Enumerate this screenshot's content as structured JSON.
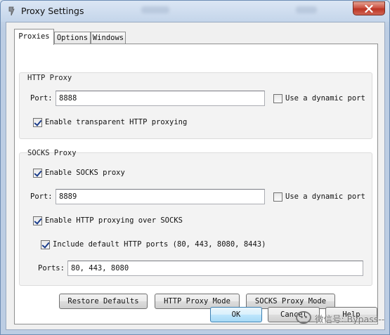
{
  "window": {
    "title": "Proxy Settings"
  },
  "tabs": [
    {
      "label": "Proxies",
      "active": true
    },
    {
      "label": "Options",
      "active": false
    },
    {
      "label": "Windows",
      "active": false
    }
  ],
  "http_proxy": {
    "group_title": "HTTP Proxy",
    "port_label": "Port:",
    "port_value": "8888",
    "dynamic_port_label": "Use a dynamic port",
    "dynamic_port_checked": false,
    "transparent_label": "Enable transparent HTTP proxying",
    "transparent_checked": true
  },
  "socks_proxy": {
    "group_title": "SOCKS Proxy",
    "enable_label": "Enable SOCKS proxy",
    "enable_checked": true,
    "port_label": "Port:",
    "port_value": "8889",
    "dynamic_port_label": "Use a dynamic port",
    "dynamic_port_checked": false,
    "http_over_socks_label": "Enable HTTP proxying over SOCKS",
    "http_over_socks_checked": true,
    "include_default_label": "Include default HTTP ports (80, 443, 8080, 8443)",
    "include_default_checked": true,
    "ports_label": "Ports:",
    "ports_value": "80, 443, 8080"
  },
  "panel_buttons": {
    "restore_defaults": "Restore Defaults",
    "http_proxy_mode": "HTTP Proxy Mode",
    "socks_proxy_mode": "SOCKS Proxy Mode"
  },
  "dialog_buttons": {
    "ok": "OK",
    "cancel": "Cancel",
    "help": "Help"
  },
  "watermark": {
    "text": "微信号: Bypass--"
  },
  "colors": {
    "title_bar": "#c4d5ea",
    "close_button": "#c8493a",
    "check_mark": "#1a3c8a",
    "default_button_border": "#3c7fb1"
  }
}
